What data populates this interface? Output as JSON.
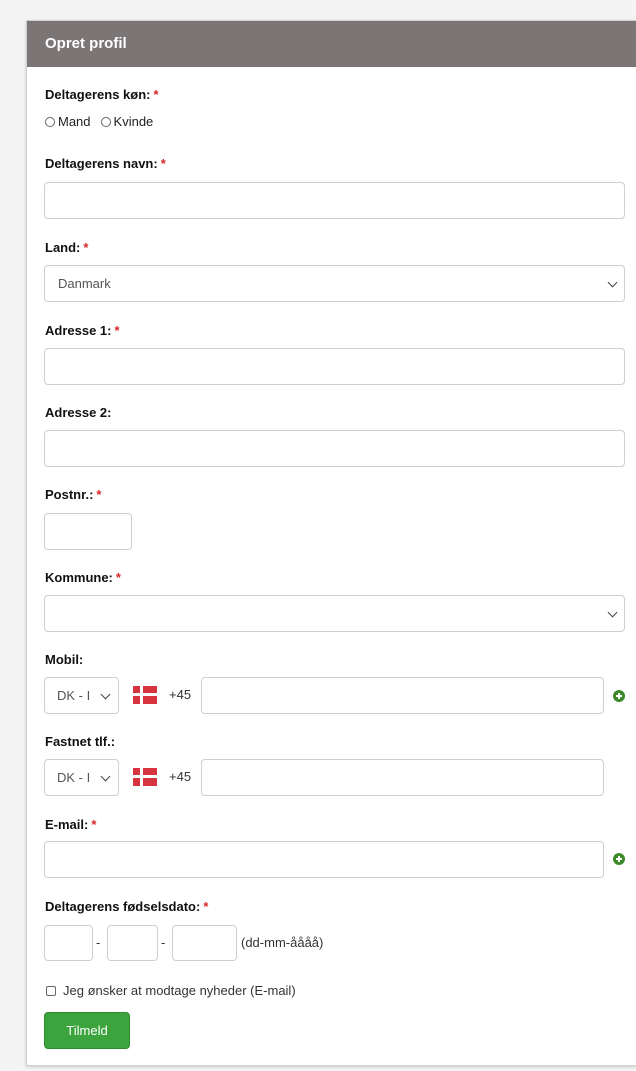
{
  "header": {
    "title": "Opret profil"
  },
  "fields": {
    "gender": {
      "label": "Deltagerens køn:",
      "required": "*",
      "options": [
        "Mand",
        "Kvinde"
      ]
    },
    "name": {
      "label": "Deltagerens navn:",
      "required": "*",
      "value": ""
    },
    "country": {
      "label": "Land:",
      "required": "*",
      "selected": "Danmark"
    },
    "address1": {
      "label": "Adresse 1:",
      "required": "*",
      "value": ""
    },
    "address2": {
      "label": "Adresse 2:",
      "value": ""
    },
    "postcode": {
      "label": "Postnr.:",
      "required": "*",
      "value": ""
    },
    "municipality": {
      "label": "Kommune:",
      "required": "*",
      "selected": ""
    },
    "mobile": {
      "label": "Mobil:",
      "country_code": "DK - I",
      "prefix": "+45",
      "value": ""
    },
    "landline": {
      "label": "Fastnet tlf.:",
      "country_code": "DK - I",
      "prefix": "+45",
      "value": ""
    },
    "email": {
      "label": "E-mail:",
      "required": "*",
      "value": ""
    },
    "birthdate": {
      "label": "Deltagerens fødselsdato:",
      "required": "*",
      "separator": "-",
      "format_hint": "(dd-mm-åååå)"
    },
    "newsletter": {
      "label": "Jeg ønsker at modtage nyheder (E-mail)",
      "checked": false
    }
  },
  "submit": {
    "label": "Tilmeld"
  },
  "colors": {
    "header_bg": "#7b7576",
    "required": "#d62828",
    "button": "#3ca43c",
    "plus_icon": "#3d8a2a"
  },
  "icons": {
    "add": "plus-circle-icon",
    "flag": "denmark-flag-icon",
    "dropdown": "chevron-down-icon",
    "spinner": "spinner-icon"
  }
}
